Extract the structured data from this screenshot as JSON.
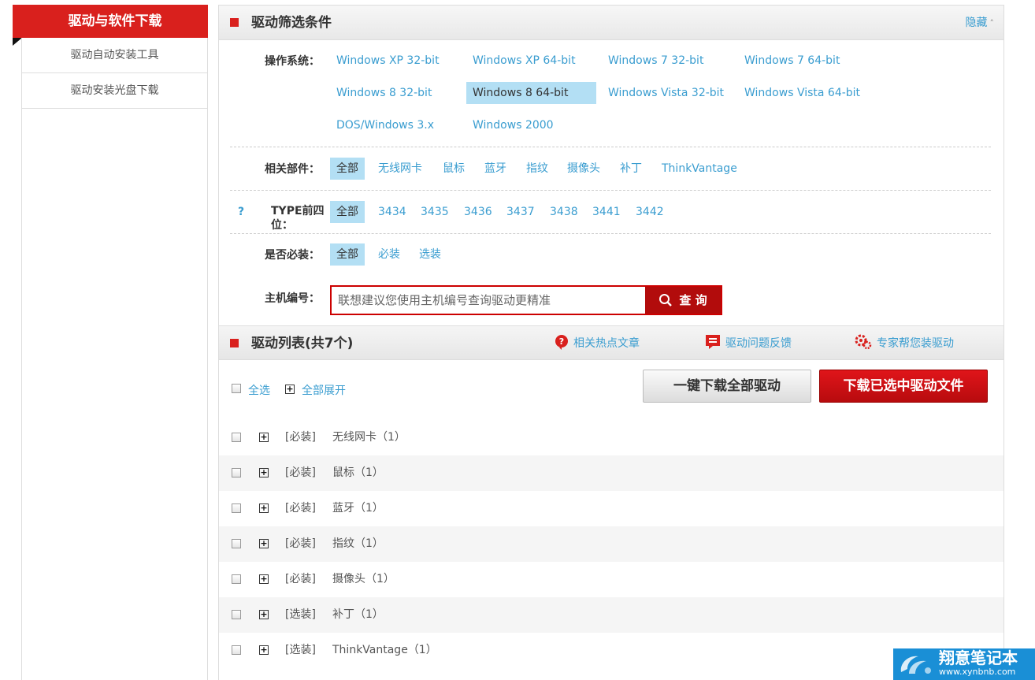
{
  "sidebar": {
    "title": "驱动与软件下载",
    "items": [
      {
        "label": "驱动自动安装工具"
      },
      {
        "label": "驱动安装光盘下载"
      }
    ]
  },
  "filter": {
    "title": "驱动筛选条件",
    "hide_label": "隐藏",
    "os": {
      "label": "操作系统：",
      "options": [
        "Windows XP 32-bit",
        "Windows XP 64-bit",
        "Windows 7 32-bit",
        "Windows 7 64-bit",
        "Windows 8 32-bit",
        "Windows 8 64-bit",
        "Windows Vista 32-bit",
        "Windows Vista 64-bit",
        "DOS/Windows 3.x",
        "Windows 2000"
      ],
      "selected": "Windows 8 64-bit"
    },
    "component": {
      "label": "相关部件：",
      "options": [
        "全部",
        "无线网卡",
        "鼠标",
        "蓝牙",
        "指纹",
        "摄像头",
        "补丁",
        "ThinkVantage"
      ],
      "selected": "全部"
    },
    "type": {
      "help": "?",
      "label": "TYPE前四位：",
      "options": [
        "全部",
        "3434",
        "3435",
        "3436",
        "3437",
        "3438",
        "3441",
        "3442"
      ],
      "selected": "全部"
    },
    "required": {
      "label": "是否必装：",
      "options": [
        "全部",
        "必装",
        "选装"
      ],
      "selected": "全部"
    },
    "machine": {
      "label": "主机编号：",
      "placeholder": "联想建议您使用主机编号查询驱动更精准",
      "button": "查 询"
    }
  },
  "driver_list": {
    "title": "驱动列表(共7个)",
    "links": [
      "相关热点文章",
      "驱动问题反馈",
      "专家帮您装驱动"
    ],
    "select_all": "全选",
    "expand_all": "全部展开",
    "download_all": "一键下载全部驱动",
    "download_selected": "下载已选中驱动文件",
    "rows": [
      {
        "tag": "[必装]",
        "name": "无线网卡（1）"
      },
      {
        "tag": "[必装]",
        "name": "鼠标（1）"
      },
      {
        "tag": "[必装]",
        "name": "蓝牙（1）"
      },
      {
        "tag": "[必装]",
        "name": "指纹（1）"
      },
      {
        "tag": "[必装]",
        "name": "摄像头（1）"
      },
      {
        "tag": "[选装]",
        "name": "补丁（1）"
      },
      {
        "tag": "[选装]",
        "name": "ThinkVantage（1）"
      }
    ]
  },
  "watermark": {
    "name": "翔意笔记本",
    "url": "www.xynbnb.com"
  },
  "colors": {
    "brand_red": "#d9201d",
    "link_blue": "#3a9dd0",
    "selected_bg": "#b3dff4"
  }
}
